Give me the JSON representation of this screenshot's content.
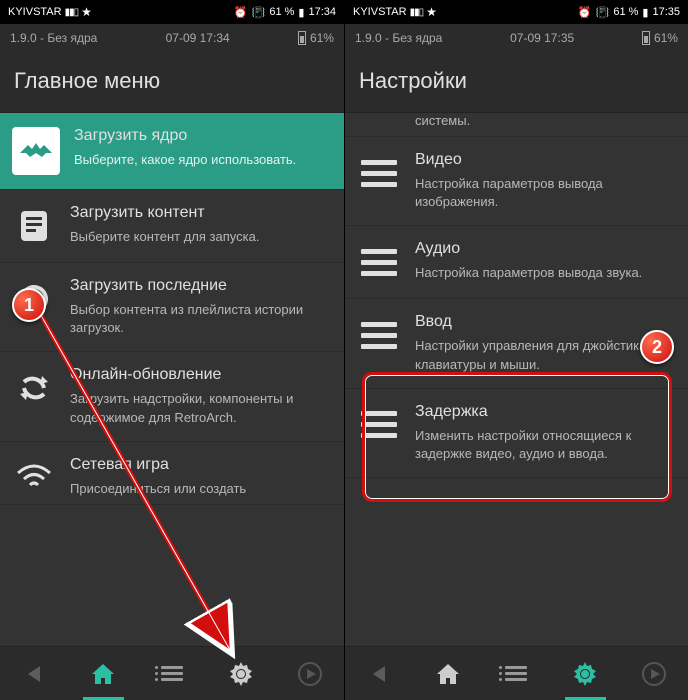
{
  "status": {
    "carrier": "KYIVSTAR",
    "battery_pct": "61 %",
    "alarm_icon": "⏰",
    "vibrate_icon": "📳",
    "time1": "17:34",
    "time2": "17:35"
  },
  "app": {
    "version": "1.9.0 - Без ядра",
    "datetime1": "07-09 17:34",
    "datetime2": "07-09 17:35",
    "battery1": "61%",
    "battery2": "61%"
  },
  "left": {
    "header": "Главное меню",
    "items": [
      {
        "title": "Загрузить ядро",
        "desc": "Выберите, какое ядро использовать.",
        "icon": "retroarch"
      },
      {
        "title": "Загрузить контент",
        "desc": "Выберите контент для запуска.",
        "icon": "file"
      },
      {
        "title": "Загрузить последние",
        "desc": "Выбор контента из плейлиста истории загрузок.",
        "icon": "history"
      },
      {
        "title": "Онлайн-обновление",
        "desc": "Загрузить надстройки, компоненты и содержимое для RetroArch.",
        "icon": "refresh"
      },
      {
        "title": "Сетевая игра",
        "desc": "Присоединиться или создать",
        "icon": "wifi"
      }
    ]
  },
  "right": {
    "header": "Настройки",
    "partial_top": "системы.",
    "items": [
      {
        "title": "Видео",
        "desc": "Настройка параметров вывода изображения."
      },
      {
        "title": "Аудио",
        "desc": "Настройка параметров вывода звука."
      },
      {
        "title": "Ввод",
        "desc": "Настройки управления для джойстика, клавиатуры и мыши."
      },
      {
        "title": "Задержка",
        "desc": "Изменить настройки относящиеся к задержке видео, аудио и ввода."
      }
    ]
  },
  "callouts": {
    "one": "1",
    "two": "2"
  }
}
